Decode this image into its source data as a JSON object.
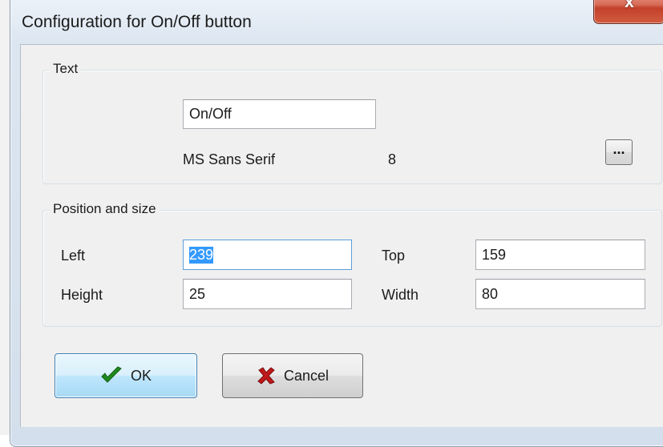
{
  "window": {
    "title": "Configuration for On/Off button",
    "close_glyph": "x"
  },
  "text_group": {
    "legend": "Text",
    "text_value": "On/Off",
    "font_name": "MS Sans Serif",
    "font_size": "8",
    "font_button_label": "..."
  },
  "position_group": {
    "legend": "Position and size",
    "left_label": "Left",
    "left_value": "239",
    "top_label": "Top",
    "top_value": "159",
    "height_label": "Height",
    "height_value": "25",
    "width_label": "Width",
    "width_value": "80"
  },
  "buttons": {
    "ok_label": "OK",
    "cancel_label": "Cancel"
  },
  "icons": {
    "ok": "check-icon",
    "cancel": "cross-icon"
  },
  "colors": {
    "check_green": "#1e8a1e",
    "cross_red": "#c0181b",
    "selection_blue": "#3399ff",
    "close_red": "#c8472f"
  }
}
